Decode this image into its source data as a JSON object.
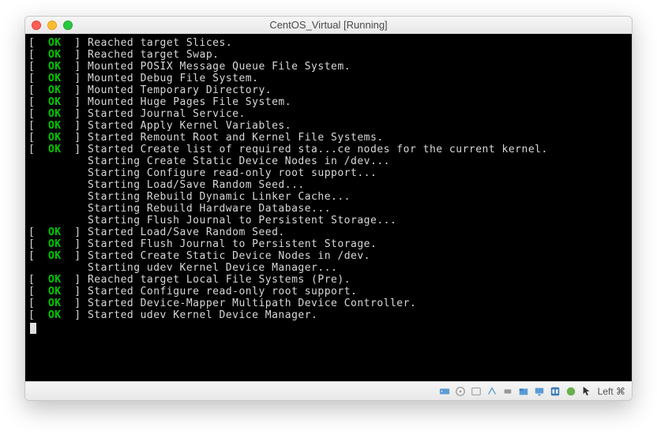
{
  "window": {
    "title": "CentOS_Virtual [Running]"
  },
  "console": {
    "lines": [
      {
        "status": "OK",
        "text": "Reached target Slices."
      },
      {
        "status": "OK",
        "text": "Reached target Swap."
      },
      {
        "status": "OK",
        "text": "Mounted POSIX Message Queue File System."
      },
      {
        "status": "OK",
        "text": "Mounted Debug File System."
      },
      {
        "status": "OK",
        "text": "Mounted Temporary Directory."
      },
      {
        "status": "OK",
        "text": "Mounted Huge Pages File System."
      },
      {
        "status": "OK",
        "text": "Started Journal Service."
      },
      {
        "status": "OK",
        "text": "Started Apply Kernel Variables."
      },
      {
        "status": "OK",
        "text": "Started Remount Root and Kernel File Systems."
      },
      {
        "status": "OK",
        "text": "Started Create list of required sta...ce nodes for the current kernel."
      },
      {
        "status": null,
        "text": "Starting Create Static Device Nodes in /dev..."
      },
      {
        "status": null,
        "text": "Starting Configure read-only root support..."
      },
      {
        "status": null,
        "text": "Starting Load/Save Random Seed..."
      },
      {
        "status": null,
        "text": "Starting Rebuild Dynamic Linker Cache..."
      },
      {
        "status": null,
        "text": "Starting Rebuild Hardware Database..."
      },
      {
        "status": null,
        "text": "Starting Flush Journal to Persistent Storage..."
      },
      {
        "status": "OK",
        "text": "Started Load/Save Random Seed."
      },
      {
        "status": "OK",
        "text": "Started Flush Journal to Persistent Storage."
      },
      {
        "status": "OK",
        "text": "Started Create Static Device Nodes in /dev."
      },
      {
        "status": null,
        "text": "Starting udev Kernel Device Manager..."
      },
      {
        "status": "OK",
        "text": "Reached target Local File Systems (Pre)."
      },
      {
        "status": "OK",
        "text": "Started Configure read-only root support."
      },
      {
        "status": "OK",
        "text": "Started Device-Mapper Multipath Device Controller."
      },
      {
        "status": "OK",
        "text": "Started udev Kernel Device Manager."
      }
    ]
  },
  "statusbar": {
    "hostkey_label": "Left ⌘"
  }
}
